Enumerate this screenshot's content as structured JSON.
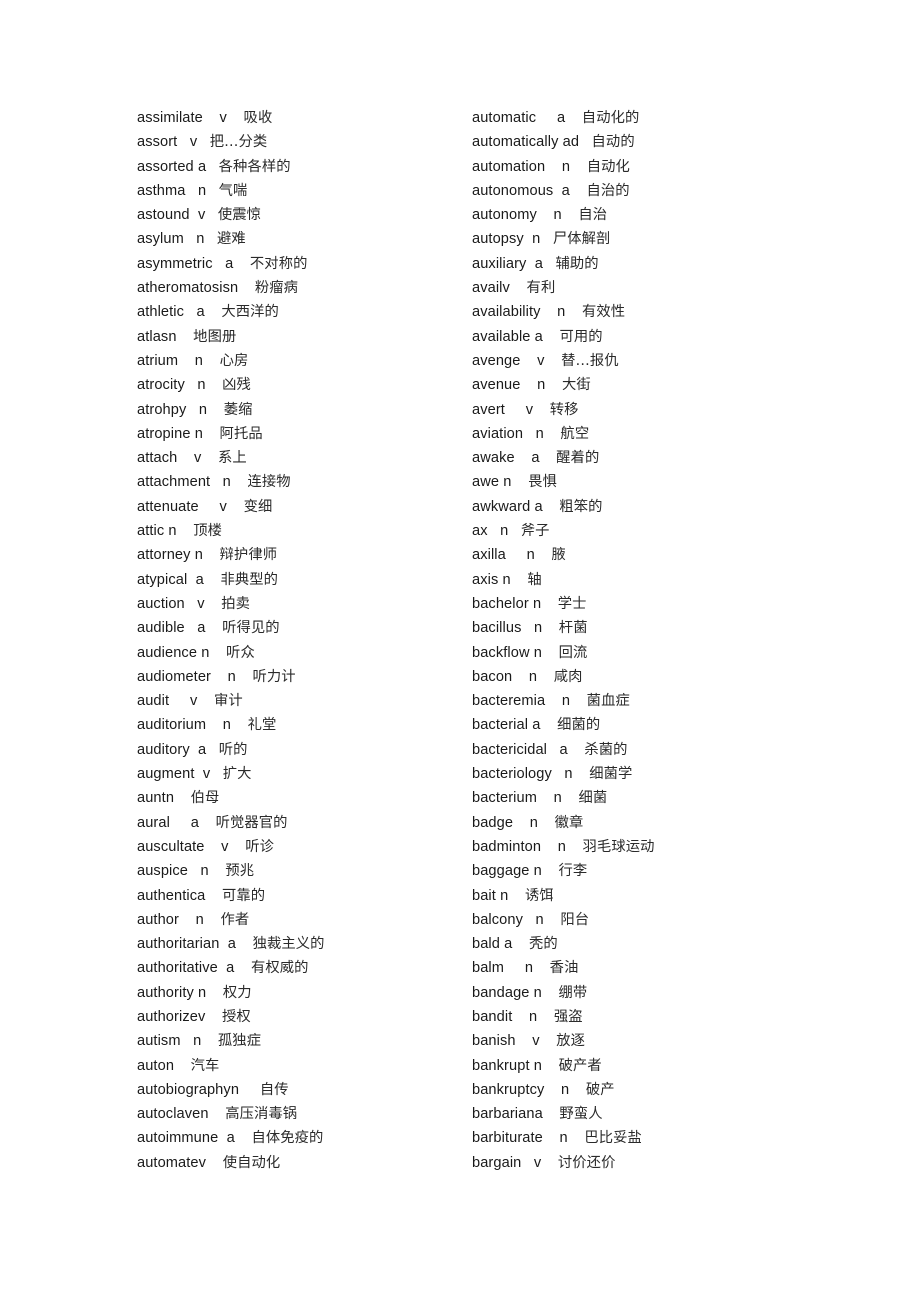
{
  "document": {
    "type": "glossary",
    "language_pair": "English-Chinese",
    "columns_per_page": 2,
    "entries_per_column": 44
  },
  "left_column": [
    {
      "term": "assimilate",
      "gap1": "    ",
      "pos": "v",
      "gap2": "    ",
      "meaning": "吸收"
    },
    {
      "term": "assort",
      "gap1": "   ",
      "pos": "v",
      "gap2": "   ",
      "meaning": "把…分类"
    },
    {
      "term": "assorted",
      "gap1": " ",
      "pos": "a",
      "gap2": "   ",
      "meaning": "各种各样的"
    },
    {
      "term": "asthma",
      "gap1": "   ",
      "pos": "n",
      "gap2": "   ",
      "meaning": "气喘"
    },
    {
      "term": "astound",
      "gap1": "  ",
      "pos": "v",
      "gap2": "   ",
      "meaning": "使震惊"
    },
    {
      "term": "asylum",
      "gap1": "   ",
      "pos": "n",
      "gap2": "   ",
      "meaning": "避难"
    },
    {
      "term": "asymmetric",
      "gap1": "   ",
      "pos": "a",
      "gap2": "    ",
      "meaning": "不对称的"
    },
    {
      "term": "atheromatosis",
      "gap1": "",
      "pos": "n",
      "gap2": "    ",
      "meaning": "粉瘤病"
    },
    {
      "term": "athletic",
      "gap1": "   ",
      "pos": "a",
      "gap2": "    ",
      "meaning": "大西洋的"
    },
    {
      "term": "atlas",
      "gap1": "",
      "pos": "n",
      "gap2": "    ",
      "meaning": "地图册"
    },
    {
      "term": "atrium",
      "gap1": "    ",
      "pos": "n",
      "gap2": "    ",
      "meaning": "心房"
    },
    {
      "term": "atrocity",
      "gap1": "   ",
      "pos": "n",
      "gap2": "    ",
      "meaning": "凶残"
    },
    {
      "term": "atrohpy",
      "gap1": "   ",
      "pos": "n",
      "gap2": "    ",
      "meaning": "萎缩"
    },
    {
      "term": "atropine",
      "gap1": " ",
      "pos": "n",
      "gap2": "    ",
      "meaning": "阿托品"
    },
    {
      "term": "attach",
      "gap1": "    ",
      "pos": "v",
      "gap2": "    ",
      "meaning": "系上"
    },
    {
      "term": "attachment",
      "gap1": "   ",
      "pos": "n",
      "gap2": "    ",
      "meaning": "连接物"
    },
    {
      "term": "attenuate",
      "gap1": "     ",
      "pos": "v",
      "gap2": "    ",
      "meaning": "变细"
    },
    {
      "term": "attic",
      "gap1": " ",
      "pos": "n",
      "gap2": "    ",
      "meaning": "顶楼"
    },
    {
      "term": "attorney",
      "gap1": " ",
      "pos": "n",
      "gap2": "    ",
      "meaning": "辩护律师"
    },
    {
      "term": "atypical",
      "gap1": "  ",
      "pos": "a",
      "gap2": "    ",
      "meaning": "非典型的"
    },
    {
      "term": "auction",
      "gap1": "   ",
      "pos": "v",
      "gap2": "    ",
      "meaning": "拍卖"
    },
    {
      "term": "audible",
      "gap1": "   ",
      "pos": "a",
      "gap2": "    ",
      "meaning": "听得见的"
    },
    {
      "term": "audience",
      "gap1": " ",
      "pos": "n",
      "gap2": "    ",
      "meaning": "听众"
    },
    {
      "term": "audiometer",
      "gap1": "    ",
      "pos": "n",
      "gap2": "    ",
      "meaning": "听力计"
    },
    {
      "term": "audit",
      "gap1": "     ",
      "pos": "v",
      "gap2": "    ",
      "meaning": "审计"
    },
    {
      "term": "auditorium",
      "gap1": "    ",
      "pos": "n",
      "gap2": "    ",
      "meaning": "礼堂"
    },
    {
      "term": "auditory",
      "gap1": "  ",
      "pos": "a",
      "gap2": "   ",
      "meaning": "听的"
    },
    {
      "term": "augment",
      "gap1": "  ",
      "pos": "v",
      "gap2": "   ",
      "meaning": "扩大"
    },
    {
      "term": "aunt",
      "gap1": "",
      "pos": "n",
      "gap2": "    ",
      "meaning": "伯母"
    },
    {
      "term": "aural",
      "gap1": "     ",
      "pos": "a",
      "gap2": "    ",
      "meaning": "听觉器官的"
    },
    {
      "term": "auscultate",
      "gap1": "    ",
      "pos": "v",
      "gap2": "    ",
      "meaning": "听诊"
    },
    {
      "term": "auspice",
      "gap1": "   ",
      "pos": "n",
      "gap2": "    ",
      "meaning": "预兆"
    },
    {
      "term": "authentic",
      "gap1": "",
      "pos": "a",
      "gap2": "    ",
      "meaning": "可靠的"
    },
    {
      "term": "author",
      "gap1": "    ",
      "pos": "n",
      "gap2": "    ",
      "meaning": "作者"
    },
    {
      "term": "authoritarian",
      "gap1": "  ",
      "pos": "a",
      "gap2": "    ",
      "meaning": "独裁主义的"
    },
    {
      "term": "authoritative",
      "gap1": "  ",
      "pos": "a",
      "gap2": "    ",
      "meaning": "有权威的"
    },
    {
      "term": "authority",
      "gap1": " ",
      "pos": "n",
      "gap2": "    ",
      "meaning": "权力"
    },
    {
      "term": "authorize",
      "gap1": "",
      "pos": "v",
      "gap2": "    ",
      "meaning": "授权"
    },
    {
      "term": "autism",
      "gap1": "   ",
      "pos": "n",
      "gap2": "    ",
      "meaning": "孤独症"
    },
    {
      "term": "auto",
      "gap1": "",
      "pos": "n",
      "gap2": "    ",
      "meaning": "汽车"
    },
    {
      "term": "autobiography",
      "gap1": "",
      "pos": "n",
      "gap2": "     ",
      "meaning": "自传"
    },
    {
      "term": "autoclave",
      "gap1": "",
      "pos": "n",
      "gap2": "    ",
      "meaning": "高压消毒锅"
    },
    {
      "term": "autoimmune",
      "gap1": "  ",
      "pos": "a",
      "gap2": "    ",
      "meaning": "自体免疫的"
    },
    {
      "term": "automate",
      "gap1": "",
      "pos": "v",
      "gap2": "    ",
      "meaning": "使自动化"
    }
  ],
  "right_column": [
    {
      "term": "automatic",
      "gap1": "     ",
      "pos": "a",
      "gap2": "    ",
      "meaning": "自动化的"
    },
    {
      "term": "automatically",
      "gap1": " ",
      "pos": "ad",
      "gap2": "   ",
      "meaning": "自动的"
    },
    {
      "term": "automation",
      "gap1": "    ",
      "pos": "n",
      "gap2": "    ",
      "meaning": "自动化"
    },
    {
      "term": "autonomous",
      "gap1": "  ",
      "pos": "a",
      "gap2": "    ",
      "meaning": "自治的"
    },
    {
      "term": "autonomy",
      "gap1": "    ",
      "pos": "n",
      "gap2": "    ",
      "meaning": "自治"
    },
    {
      "term": "autopsy",
      "gap1": "  ",
      "pos": "n",
      "gap2": "   ",
      "meaning": "尸体解剖"
    },
    {
      "term": "auxiliary",
      "gap1": "  ",
      "pos": "a",
      "gap2": "   ",
      "meaning": "辅助的"
    },
    {
      "term": "avail",
      "gap1": "",
      "pos": "v",
      "gap2": "    ",
      "meaning": "有利"
    },
    {
      "term": "availability",
      "gap1": "    ",
      "pos": "n",
      "gap2": "    ",
      "meaning": "有效性"
    },
    {
      "term": "available",
      "gap1": " ",
      "pos": "a",
      "gap2": "    ",
      "meaning": "可用的"
    },
    {
      "term": "avenge",
      "gap1": "    ",
      "pos": "v",
      "gap2": "    ",
      "meaning": "替…报仇"
    },
    {
      "term": "avenue",
      "gap1": "    ",
      "pos": "n",
      "gap2": "    ",
      "meaning": "大街"
    },
    {
      "term": "avert",
      "gap1": "     ",
      "pos": "v",
      "gap2": "    ",
      "meaning": "转移"
    },
    {
      "term": "aviation",
      "gap1": "   ",
      "pos": "n",
      "gap2": "    ",
      "meaning": "航空"
    },
    {
      "term": "awake",
      "gap1": "    ",
      "pos": "a",
      "gap2": "    ",
      "meaning": "醒着的"
    },
    {
      "term": "awe",
      "gap1": " ",
      "pos": "n",
      "gap2": "    ",
      "meaning": "畏惧"
    },
    {
      "term": "awkward",
      "gap1": " ",
      "pos": "a",
      "gap2": "    ",
      "meaning": "粗笨的"
    },
    {
      "term": "ax",
      "gap1": "   ",
      "pos": "n",
      "gap2": "   ",
      "meaning": "斧子"
    },
    {
      "term": "axilla",
      "gap1": "     ",
      "pos": "n",
      "gap2": "    ",
      "meaning": "腋"
    },
    {
      "term": "axis",
      "gap1": " ",
      "pos": "n",
      "gap2": "    ",
      "meaning": "轴"
    },
    {
      "term": "bachelor",
      "gap1": " ",
      "pos": "n",
      "gap2": "    ",
      "meaning": "学士"
    },
    {
      "term": "bacillus",
      "gap1": "   ",
      "pos": "n",
      "gap2": "    ",
      "meaning": "杆菌"
    },
    {
      "term": "backflow",
      "gap1": " ",
      "pos": "n",
      "gap2": "    ",
      "meaning": "回流"
    },
    {
      "term": "bacon",
      "gap1": "    ",
      "pos": "n",
      "gap2": "    ",
      "meaning": "咸肉"
    },
    {
      "term": "bacteremia",
      "gap1": "    ",
      "pos": "n",
      "gap2": "    ",
      "meaning": "菌血症"
    },
    {
      "term": "bacterial",
      "gap1": " ",
      "pos": "a",
      "gap2": "    ",
      "meaning": "细菌的"
    },
    {
      "term": "bactericidal",
      "gap1": "   ",
      "pos": "a",
      "gap2": "    ",
      "meaning": "杀菌的"
    },
    {
      "term": "bacteriology",
      "gap1": "   ",
      "pos": "n",
      "gap2": "    ",
      "meaning": "细菌学"
    },
    {
      "term": "bacterium",
      "gap1": "    ",
      "pos": "n",
      "gap2": "    ",
      "meaning": "细菌"
    },
    {
      "term": "badge",
      "gap1": "    ",
      "pos": "n",
      "gap2": "    ",
      "meaning": "徽章"
    },
    {
      "term": "badminton",
      "gap1": "    ",
      "pos": "n",
      "gap2": "    ",
      "meaning": "羽毛球运动"
    },
    {
      "term": "baggage",
      "gap1": " ",
      "pos": "n",
      "gap2": "    ",
      "meaning": "行李"
    },
    {
      "term": "bait",
      "gap1": " ",
      "pos": "n",
      "gap2": "    ",
      "meaning": "诱饵"
    },
    {
      "term": "balcony",
      "gap1": "   ",
      "pos": "n",
      "gap2": "    ",
      "meaning": "阳台"
    },
    {
      "term": "bald",
      "gap1": " ",
      "pos": "a",
      "gap2": "    ",
      "meaning": "秃的"
    },
    {
      "term": "balm",
      "gap1": "     ",
      "pos": "n",
      "gap2": "    ",
      "meaning": "香油"
    },
    {
      "term": "bandage",
      "gap1": " ",
      "pos": "n",
      "gap2": "    ",
      "meaning": "绷带"
    },
    {
      "term": "bandit",
      "gap1": "    ",
      "pos": "n",
      "gap2": "    ",
      "meaning": "强盗"
    },
    {
      "term": "banish",
      "gap1": "    ",
      "pos": "v",
      "gap2": "    ",
      "meaning": "放逐"
    },
    {
      "term": "bankrupt",
      "gap1": " ",
      "pos": "n",
      "gap2": "    ",
      "meaning": "破产者"
    },
    {
      "term": "bankruptcy",
      "gap1": "    ",
      "pos": "n",
      "gap2": "    ",
      "meaning": "破产"
    },
    {
      "term": "barbarian",
      "gap1": "",
      "pos": "a",
      "gap2": "    ",
      "meaning": "野蛮人"
    },
    {
      "term": "barbiturate",
      "gap1": "    ",
      "pos": "n",
      "gap2": "    ",
      "meaning": "巴比妥盐"
    },
    {
      "term": "bargain",
      "gap1": "   ",
      "pos": "v",
      "gap2": "    ",
      "meaning": "讨价还价"
    }
  ]
}
